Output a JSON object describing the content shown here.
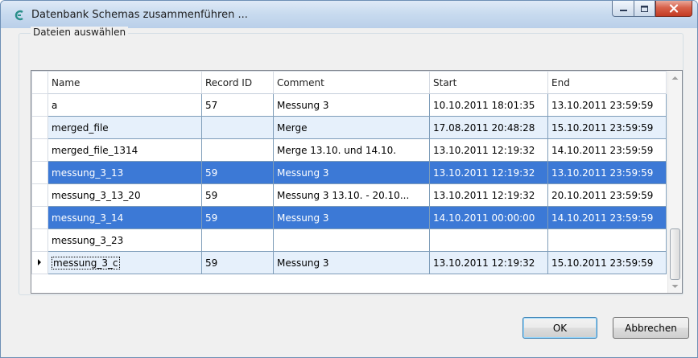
{
  "window": {
    "title": "Datenbank Schemas zusammenführen ...",
    "app_icon": "connector-icon",
    "controls": [
      "minimize-icon",
      "maximize-icon",
      "close-icon"
    ]
  },
  "group": {
    "label": "Dateien auswählen"
  },
  "table": {
    "columns": [
      "Name",
      "Record ID",
      "Comment",
      "Start",
      "End"
    ],
    "rows": [
      {
        "name": "a",
        "record_id": "57",
        "comment": "Messung 3",
        "start": "10.10.2011 18:01:35",
        "end": "13.10.2011 23:59:59"
      },
      {
        "name": "merged_file",
        "record_id": "",
        "comment": "Merge",
        "start": "17.08.2011 20:48:28",
        "end": "15.10.2011 23:59:59"
      },
      {
        "name": "merged_file_1314",
        "record_id": "",
        "comment": "Merge 13.10. und 14.10.",
        "start": "13.10.2011 12:19:32",
        "end": "14.10.2011 23:59:59"
      },
      {
        "name": "messung_3_13",
        "record_id": "59",
        "comment": "Messung 3",
        "start": "13.10.2011 12:19:32",
        "end": "13.10.2011 23:59:59"
      },
      {
        "name": "messung_3_13_20",
        "record_id": "59",
        "comment": "Messung 3 13.10. - 20.10...",
        "start": "13.10.2011 12:19:32",
        "end": "20.10.2011 23:59:59"
      },
      {
        "name": "messung_3_14",
        "record_id": "59",
        "comment": "Messung 3",
        "start": "14.10.2011 00:00:00",
        "end": "14.10.2011 23:59:59"
      },
      {
        "name": "messung_3_23",
        "record_id": "",
        "comment": "",
        "start": "",
        "end": ""
      },
      {
        "name": "messung_3_c",
        "record_id": "59",
        "comment": "Messung 3",
        "start": "13.10.2011 12:19:32",
        "end": "15.10.2011 23:59:59"
      }
    ],
    "selected_rows": [
      3,
      5
    ],
    "current_row": 7,
    "alternate_color": "#e6f0fb",
    "selection_color": "#3c79d6"
  },
  "buttons": {
    "ok": "OK",
    "cancel": "Abbrechen"
  }
}
